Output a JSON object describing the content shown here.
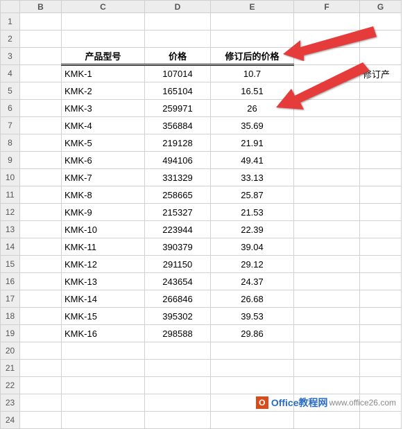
{
  "columns": {
    "B": "B",
    "C": "C",
    "D": "D",
    "E": "E",
    "F": "F",
    "G": "G"
  },
  "headers": {
    "product_model": "产品型号",
    "price": "价格",
    "revised_price": "修订后的价格",
    "corner": "修订产"
  },
  "rows": [
    {
      "c": "KMK-1",
      "d": "107014",
      "e": "10.7"
    },
    {
      "c": "KMK-2",
      "d": "165104",
      "e": "16.51"
    },
    {
      "c": "KMK-3",
      "d": "259971",
      "e": "26"
    },
    {
      "c": "KMK-4",
      "d": "356884",
      "e": "35.69"
    },
    {
      "c": "KMK-5",
      "d": "219128",
      "e": "21.91"
    },
    {
      "c": "KMK-6",
      "d": "494106",
      "e": "49.41"
    },
    {
      "c": "KMK-7",
      "d": "331329",
      "e": "33.13"
    },
    {
      "c": "KMK-8",
      "d": "258665",
      "e": "25.87"
    },
    {
      "c": "KMK-9",
      "d": "215327",
      "e": "21.53"
    },
    {
      "c": "KMK-10",
      "d": "223944",
      "e": "22.39"
    },
    {
      "c": "KMK-11",
      "d": "390379",
      "e": "39.04"
    },
    {
      "c": "KMK-12",
      "d": "291150",
      "e": "29.12"
    },
    {
      "c": "KMK-13",
      "d": "243654",
      "e": "24.37"
    },
    {
      "c": "KMK-14",
      "d": "266846",
      "e": "26.68"
    },
    {
      "c": "KMK-15",
      "d": "395302",
      "e": "39.53"
    },
    {
      "c": "KMK-16",
      "d": "298588",
      "e": "29.86"
    }
  ],
  "row_numbers": [
    "1",
    "2",
    "3",
    "4",
    "5",
    "6",
    "7",
    "8",
    "9",
    "10",
    "11",
    "12",
    "13",
    "14",
    "15",
    "16",
    "17",
    "18",
    "19",
    "20",
    "21",
    "22",
    "23",
    "24"
  ],
  "watermark": {
    "brand": "Office教程网",
    "url": "www.office26.com",
    "glyph": "O"
  },
  "arrow_color": "#e53b3b"
}
